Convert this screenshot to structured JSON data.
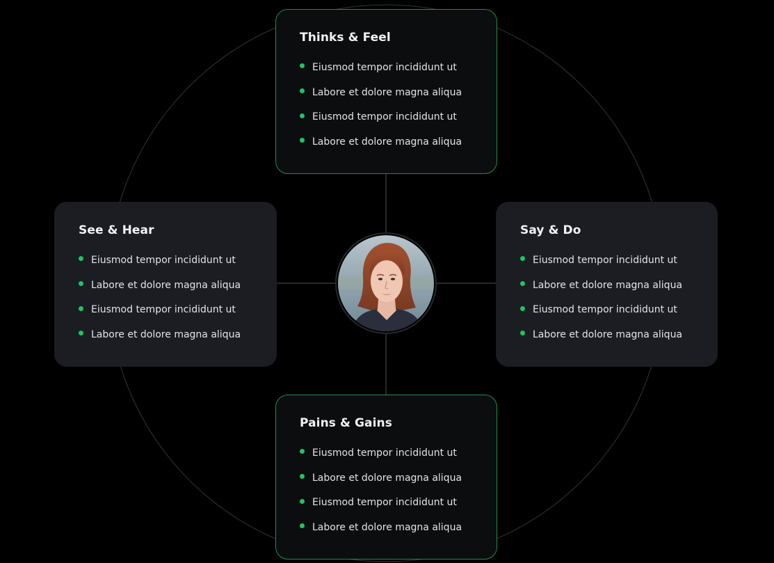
{
  "accent_color": "#1fc463",
  "center": {
    "avatar_icon": "person-portrait"
  },
  "quadrants": {
    "top": {
      "title": "Thinks & Feel",
      "items": [
        "Eiusmod tempor incididunt ut",
        "Labore et dolore magna aliqua",
        "Eiusmod tempor incididunt ut",
        "Labore et dolore magna aliqua"
      ]
    },
    "left": {
      "title": "See & Hear",
      "items": [
        "Eiusmod tempor incididunt ut",
        "Labore et dolore magna aliqua",
        "Eiusmod tempor incididunt ut",
        "Labore et dolore magna aliqua"
      ]
    },
    "right": {
      "title": "Say & Do",
      "items": [
        "Eiusmod tempor incididunt ut",
        "Labore et dolore magna aliqua",
        "Eiusmod tempor incididunt ut",
        "Labore et dolore magna aliqua"
      ]
    },
    "bottom": {
      "title": "Pains & Gains",
      "items": [
        "Eiusmod tempor incididunt ut",
        "Labore et dolore magna aliqua",
        "Eiusmod tempor incididunt ut",
        "Labore et dolore magna aliqua"
      ]
    }
  }
}
